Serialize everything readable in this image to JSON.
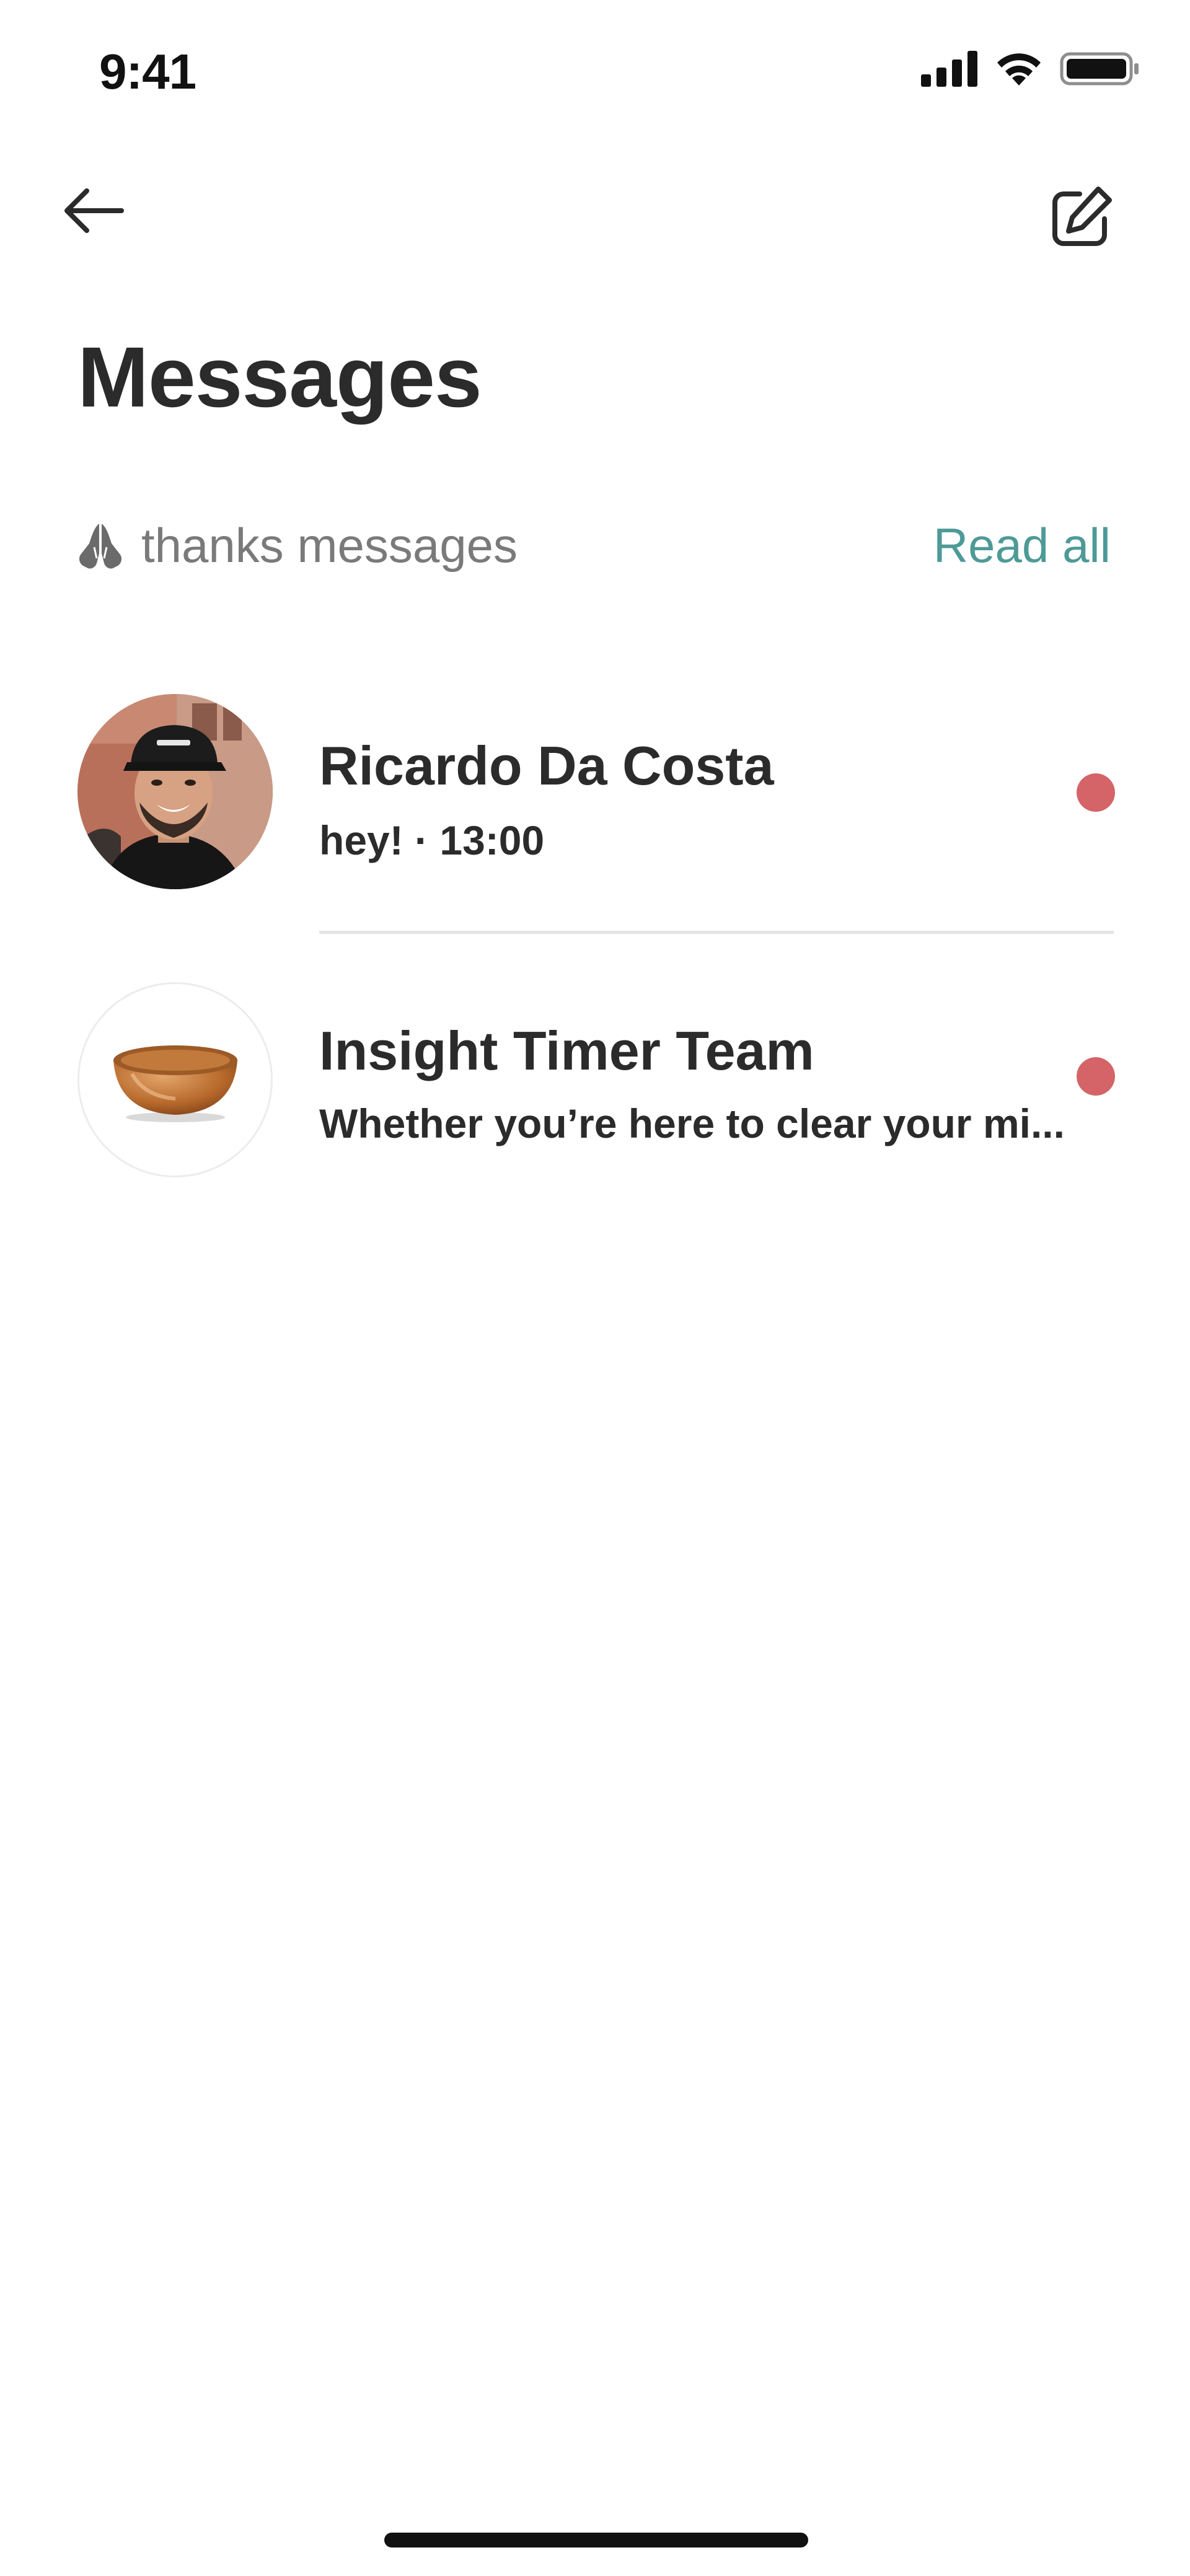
{
  "status_bar": {
    "time": "9:41"
  },
  "header": {
    "title": "Messages"
  },
  "thanks": {
    "icon": "praying-hands-icon",
    "label": "thanks messages",
    "read_all": "Read all"
  },
  "conversations": [
    {
      "name": "Ricardo Da Costa",
      "preview": "hey! · 13:00",
      "avatar": "profile-photo",
      "unread": true
    },
    {
      "name": "Insight Timer Team",
      "preview": "Whether you’re here to clear your mi...",
      "avatar": "singing-bowl-image",
      "unread": true
    }
  ],
  "colors": {
    "accent": "#4d9a97",
    "unread": "#d46468",
    "text": "#2b2b2b",
    "muted": "#7a7a7a"
  }
}
